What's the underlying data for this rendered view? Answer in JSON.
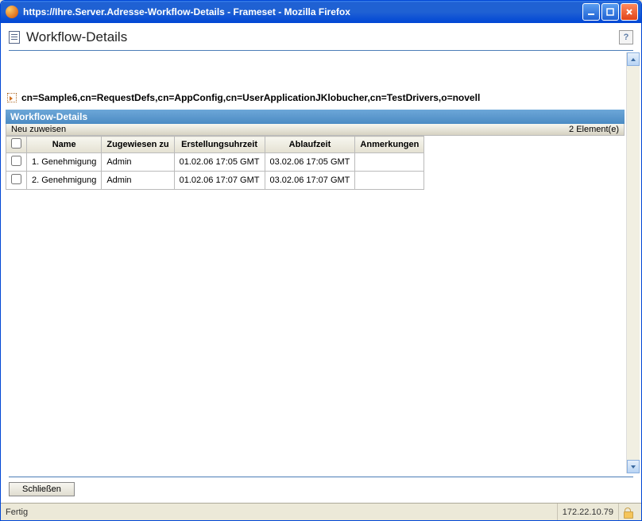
{
  "window": {
    "title": "https://Ihre.Server.Adresse-Workflow-Details - Frameset - Mozilla Firefox"
  },
  "header": {
    "title": "Workflow-Details"
  },
  "breadcrumb": "cn=Sample6,cn=RequestDefs,cn=AppConfig,cn=UserApplicationJKlobucher,cn=TestDrivers,o=novell",
  "panel": {
    "title": "Workflow-Details",
    "reassign_label": "Neu zuweisen",
    "count_label": "2 Element(e)"
  },
  "columns": {
    "name": "Name",
    "assigned": "Zugewiesen zu",
    "created": "Erstellungsuhrzeit",
    "expires": "Ablaufzeit",
    "notes": "Anmerkungen"
  },
  "rows": [
    {
      "name": "1. Genehmigung",
      "assigned": "Admin",
      "created": "01.02.06 17:05 GMT",
      "expires": "03.02.06 17:05 GMT",
      "notes": ""
    },
    {
      "name": "2. Genehmigung",
      "assigned": "Admin",
      "created": "01.02.06 17:07 GMT",
      "expires": "03.02.06 17:07 GMT",
      "notes": ""
    }
  ],
  "footer": {
    "close_label": "Schließen"
  },
  "status": {
    "left": "Fertig",
    "ip": "172.22.10.79"
  }
}
